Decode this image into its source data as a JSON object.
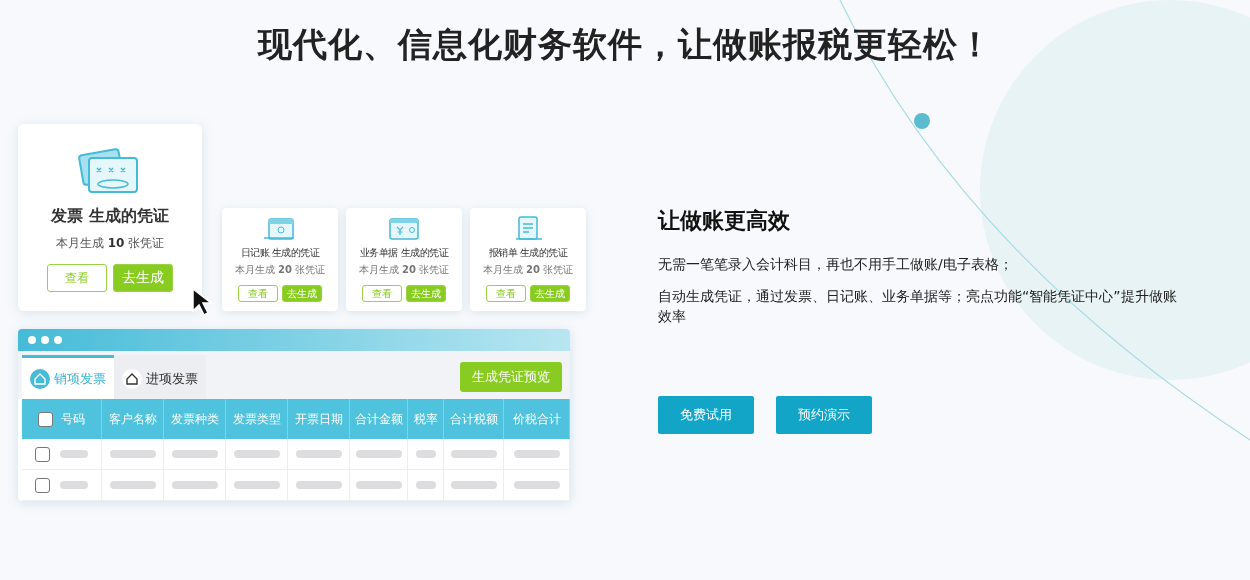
{
  "headline": "现代化、信息化财务软件，让做账报税更轻松！",
  "main_card": {
    "title": "发票 生成的凭证",
    "count": "本月生成 **10** 张凭证",
    "buttons": [
      {
        "label": "查看",
        "kind": "outline"
      },
      {
        "label": "去生成",
        "kind": "solid"
      }
    ]
  },
  "small_cards": [
    {
      "title": "日记账 生成的凭证",
      "count": "本月生成 **20** 张凭证",
      "buttons": [
        {
          "label": "查看",
          "kind": "outline"
        },
        {
          "label": "去生成",
          "kind": "solid"
        }
      ]
    },
    {
      "title": "业务单据 生成的凭证",
      "count": "本月生成 **20** 张凭证",
      "buttons": [
        {
          "label": "查看",
          "kind": "outline"
        },
        {
          "label": "去生成",
          "kind": "solid"
        }
      ]
    },
    {
      "title": "报销单 生成的凭证",
      "count": "本月生成 **20** 张凭证",
      "buttons": [
        {
          "label": "查看",
          "kind": "outline"
        },
        {
          "label": "去生成",
          "kind": "solid"
        }
      ]
    }
  ],
  "table": {
    "tabs": [
      {
        "label": "销项发票",
        "selected": true
      },
      {
        "label": "进项发票",
        "selected": false
      }
    ],
    "action_button": "生成凭证预览",
    "header_checked": false,
    "columns": [
      "号码",
      "客户名称",
      "发票种类",
      "发票类型",
      "开票日期",
      "合计金额",
      "税率",
      "合计税额",
      "价税合计"
    ],
    "rows": [
      {
        "checked": false
      },
      {
        "checked": false
      }
    ]
  },
  "feature": {
    "heading": "让做账更高效",
    "paragraphs": [
      "无需一笔笔录入会计科目，再也不用手工做账/电子表格；",
      "自动生成凭证，通过发票、日记账、业务单据等；亮点功能“智能凭证中心”提升做账效率"
    ],
    "buttons": [
      "免费试用",
      "预约演示"
    ]
  }
}
